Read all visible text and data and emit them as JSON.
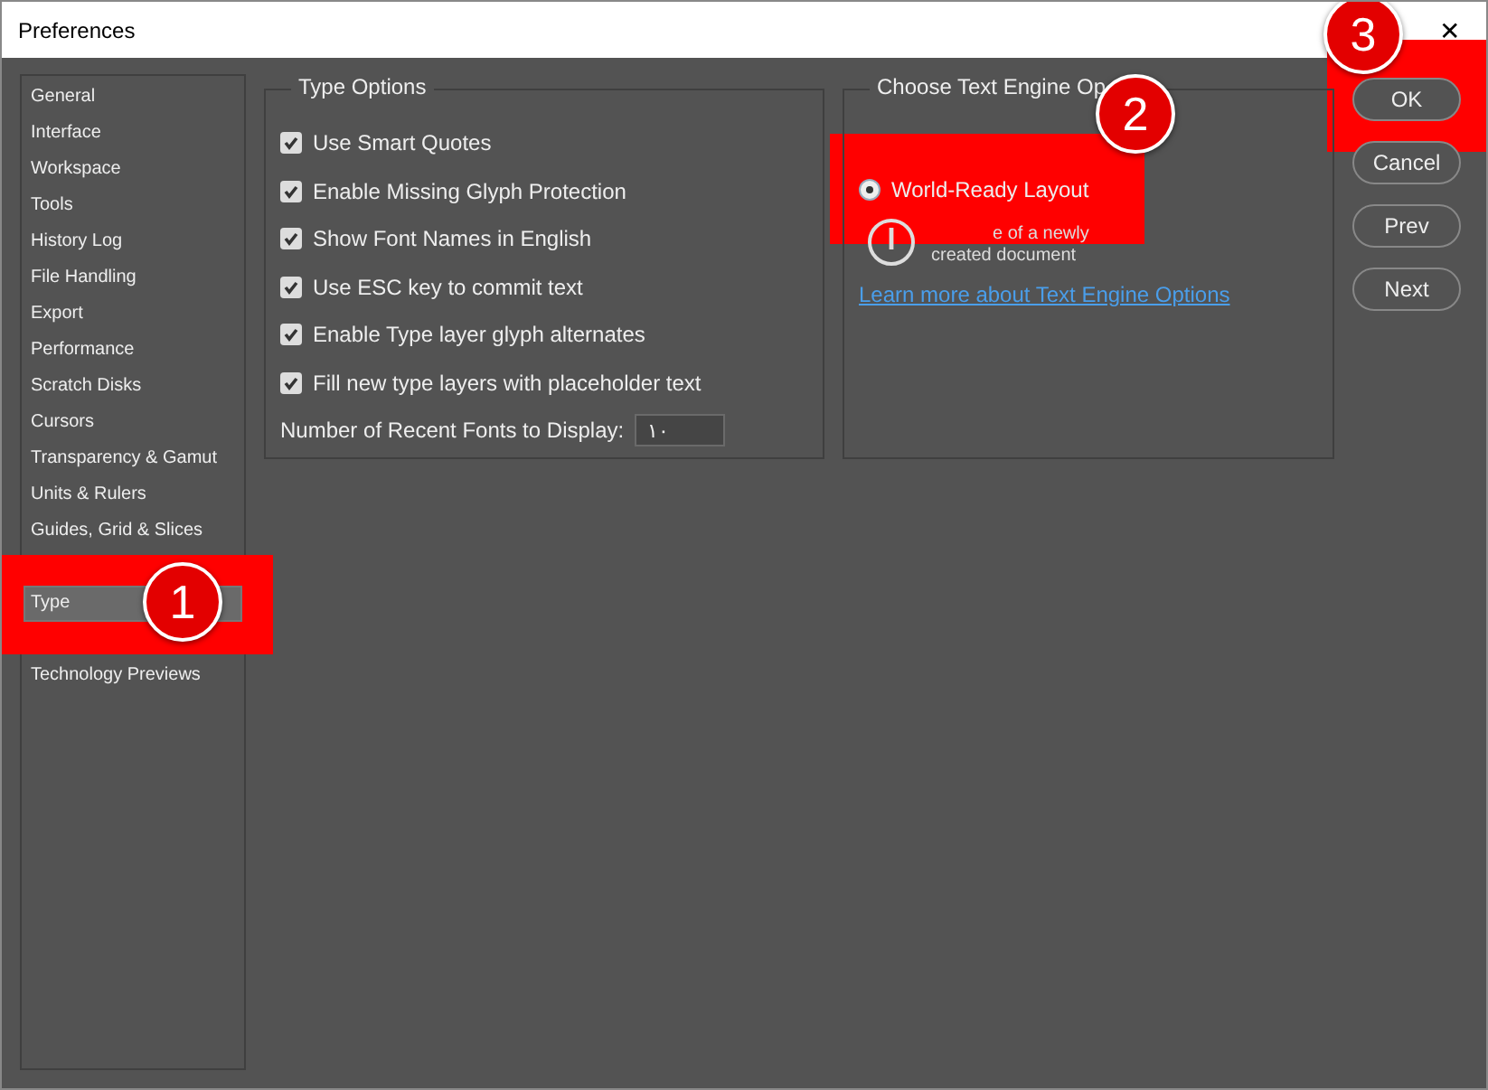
{
  "window": {
    "title": "Preferences",
    "close": "✕"
  },
  "sidebar": {
    "items": [
      {
        "label": "General",
        "selected": false
      },
      {
        "label": "Interface",
        "selected": false
      },
      {
        "label": "Workspace",
        "selected": false
      },
      {
        "label": "Tools",
        "selected": false
      },
      {
        "label": "History Log",
        "selected": false
      },
      {
        "label": "File Handling",
        "selected": false
      },
      {
        "label": "Export",
        "selected": false
      },
      {
        "label": "Performance",
        "selected": false
      },
      {
        "label": "Scratch Disks",
        "selected": false
      },
      {
        "label": "Cursors",
        "selected": false
      },
      {
        "label": "Transparency & Gamut",
        "selected": false
      },
      {
        "label": "Units & Rulers",
        "selected": false
      },
      {
        "label": "Guides, Grid & Slices",
        "selected": false
      },
      {
        "label": "Type",
        "selected": true,
        "spaced": true,
        "annotation": "1"
      },
      {
        "label": "Technology Previews",
        "selected": false,
        "spaced": true
      }
    ]
  },
  "type_options": {
    "title": "Type Options",
    "options": [
      {
        "label": "Use Smart Quotes",
        "checked": true
      },
      {
        "label": "Enable Missing Glyph Protection",
        "checked": true
      },
      {
        "label": "Show Font Names in English",
        "checked": true
      },
      {
        "label": "Use ESC key to commit text",
        "checked": true
      },
      {
        "label": "Enable Type layer glyph alternates",
        "checked": true
      },
      {
        "label": "Fill new type layers with placeholder text",
        "checked": true
      }
    ],
    "recent_fonts": {
      "label": "Number of Recent Fonts to Display:",
      "value": "١٠"
    }
  },
  "text_engine": {
    "title": "Choose Text Engine Op",
    "option": {
      "label": "World-Ready Layout",
      "selected": true,
      "annotation": "2"
    },
    "note_lines": [
      "e of a newly",
      "created document"
    ],
    "link": "Learn more about Text Engine Options"
  },
  "buttons": [
    {
      "label": "OK",
      "annotation": "3"
    },
    {
      "label": "Cancel"
    },
    {
      "label": "Prev"
    },
    {
      "label": "Next"
    }
  ]
}
